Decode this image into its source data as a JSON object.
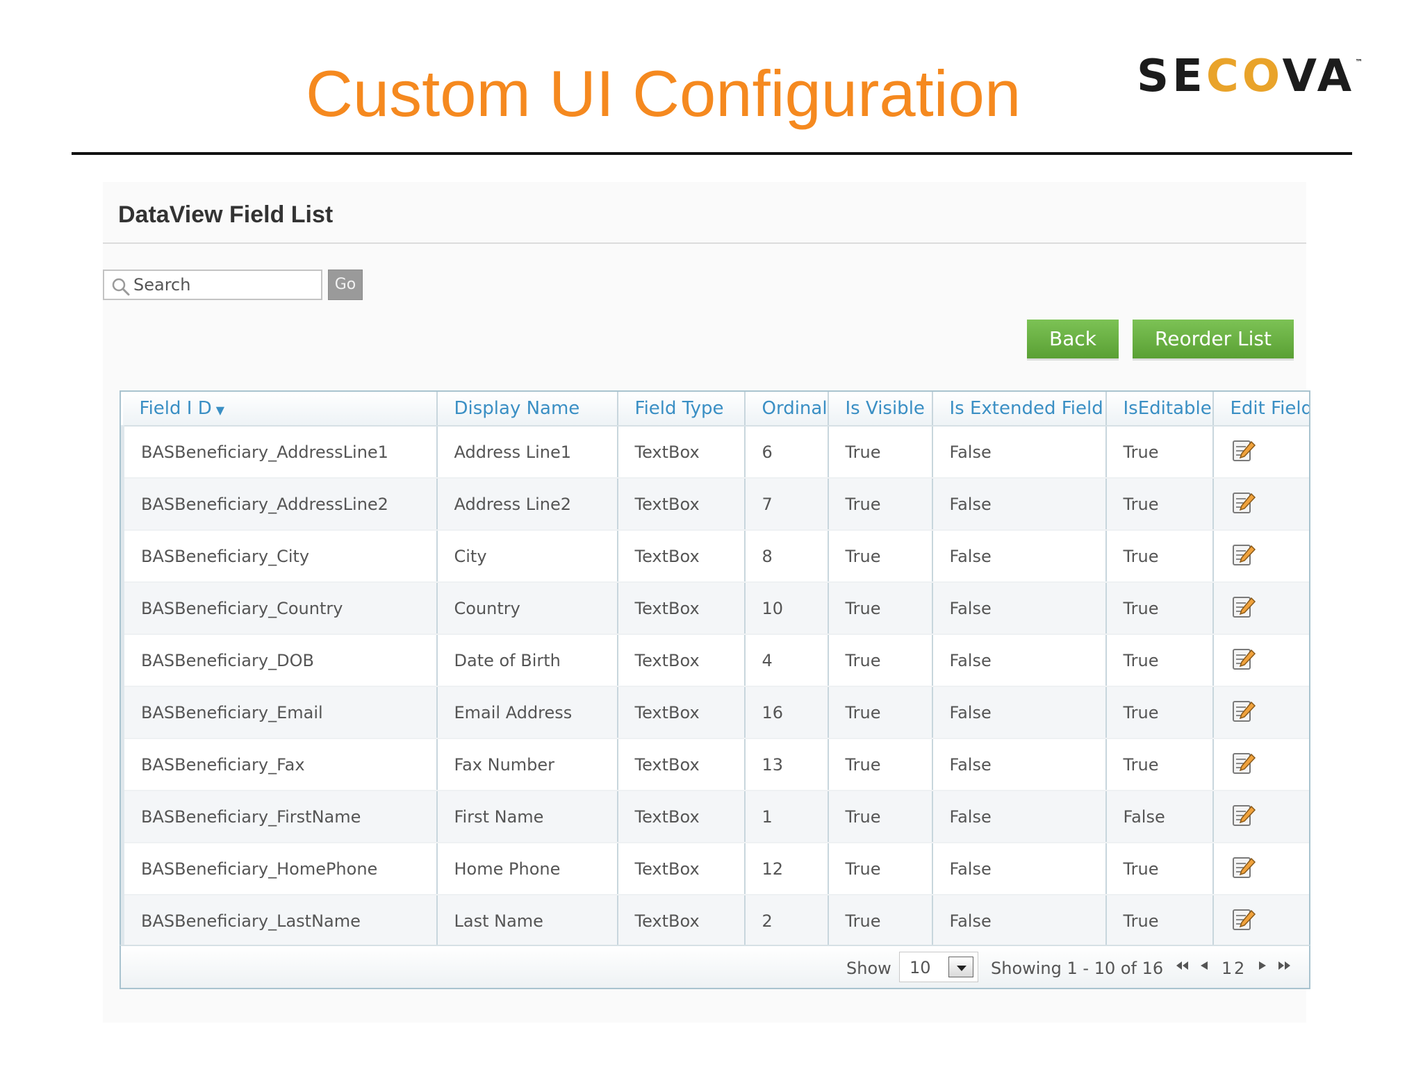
{
  "slide": {
    "title": "Custom UI Configuration",
    "brand": {
      "part1": "SE",
      "part2": "CO",
      "part3": "VA",
      "tm": "™"
    }
  },
  "panel": {
    "title": "DataView Field List",
    "search": {
      "placeholder": "Search",
      "go_label": "Go"
    },
    "buttons": {
      "back": "Back",
      "reorder": "Reorder List"
    }
  },
  "colors": {
    "title": "#f5891f",
    "button_green": "#6ab343",
    "header_text": "#3a8fc4"
  },
  "grid": {
    "columns": [
      "Field I D",
      "Display Name",
      "Field Type",
      "Ordinal",
      "Is Visible",
      "Is Extended Field",
      "IsEditable",
      "Edit Field"
    ],
    "sort_indicator": "▼",
    "rows": [
      {
        "field_id": "BASBeneficiary_AddressLine1",
        "display_name": "Address Line1",
        "field_type": "TextBox",
        "ordinal": "6",
        "is_visible": "True",
        "is_extended": "False",
        "is_editable": "True"
      },
      {
        "field_id": "BASBeneficiary_AddressLine2",
        "display_name": "Address Line2",
        "field_type": "TextBox",
        "ordinal": "7",
        "is_visible": "True",
        "is_extended": "False",
        "is_editable": "True"
      },
      {
        "field_id": "BASBeneficiary_City",
        "display_name": "City",
        "field_type": "TextBox",
        "ordinal": "8",
        "is_visible": "True",
        "is_extended": "False",
        "is_editable": "True"
      },
      {
        "field_id": "BASBeneficiary_Country",
        "display_name": "Country",
        "field_type": "TextBox",
        "ordinal": "10",
        "is_visible": "True",
        "is_extended": "False",
        "is_editable": "True"
      },
      {
        "field_id": "BASBeneficiary_DOB",
        "display_name": "Date of Birth",
        "field_type": "TextBox",
        "ordinal": "4",
        "is_visible": "True",
        "is_extended": "False",
        "is_editable": "True"
      },
      {
        "field_id": "BASBeneficiary_Email",
        "display_name": "Email Address",
        "field_type": "TextBox",
        "ordinal": "16",
        "is_visible": "True",
        "is_extended": "False",
        "is_editable": "True"
      },
      {
        "field_id": "BASBeneficiary_Fax",
        "display_name": "Fax Number",
        "field_type": "TextBox",
        "ordinal": "13",
        "is_visible": "True",
        "is_extended": "False",
        "is_editable": "True"
      },
      {
        "field_id": "BASBeneficiary_FirstName",
        "display_name": "First Name",
        "field_type": "TextBox",
        "ordinal": "1",
        "is_visible": "True",
        "is_extended": "False",
        "is_editable": "False"
      },
      {
        "field_id": "BASBeneficiary_HomePhone",
        "display_name": "Home Phone",
        "field_type": "TextBox",
        "ordinal": "12",
        "is_visible": "True",
        "is_extended": "False",
        "is_editable": "True"
      },
      {
        "field_id": "BASBeneficiary_LastName",
        "display_name": "Last Name",
        "field_type": "TextBox",
        "ordinal": "2",
        "is_visible": "True",
        "is_extended": "False",
        "is_editable": "True"
      }
    ],
    "edit_icon": "edit-note-icon"
  },
  "pager": {
    "show_label": "Show",
    "page_size": "10",
    "showing_text": "Showing 1 - 10 of 16",
    "pages": [
      "1",
      "2"
    ]
  }
}
